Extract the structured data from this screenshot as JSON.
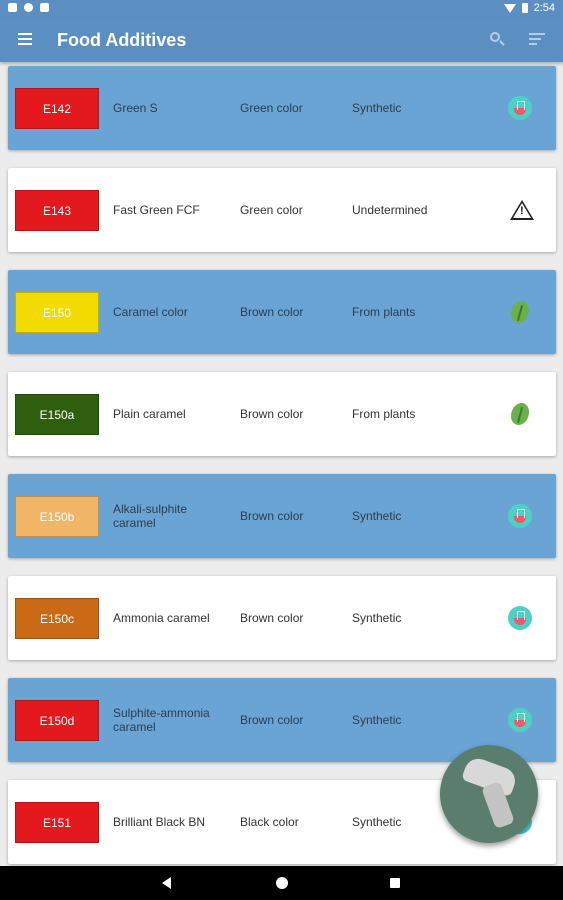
{
  "status_bar": {
    "time": "2:54"
  },
  "app_bar": {
    "title": "Food Additives",
    "icons": [
      "menu-icon",
      "search-icon",
      "sort-icon"
    ]
  },
  "additives": [
    {
      "code": "E142",
      "name": "Green S",
      "function": "Green color",
      "origin": "Synthetic",
      "code_color": "#e3191d",
      "origin_icon": "flask-icon",
      "highlight": true
    },
    {
      "code": "E143",
      "name": "Fast Green FCF",
      "function": "Green color",
      "origin": "Undetermined",
      "code_color": "#e3191d",
      "origin_icon": "warning-icon",
      "highlight": false
    },
    {
      "code": "E150",
      "name": "Caramel color",
      "function": "Brown color",
      "origin": "From plants",
      "code_color": "#f2dc00",
      "origin_icon": "leaf-icon",
      "highlight": true
    },
    {
      "code": "E150a",
      "name": "Plain caramel",
      "function": "Brown color",
      "origin": "From plants",
      "code_color": "#2f5e0e",
      "origin_icon": "leaf-icon",
      "highlight": false
    },
    {
      "code": "E150b",
      "name": "Alkali-sulphite caramel",
      "function": "Brown color",
      "origin": "Synthetic",
      "code_color": "#f0b566",
      "origin_icon": "flask-icon",
      "highlight": true
    },
    {
      "code": "E150c",
      "name": "Ammonia caramel",
      "function": "Brown color",
      "origin": "Synthetic",
      "code_color": "#ca6a16",
      "origin_icon": "flask-icon",
      "highlight": false
    },
    {
      "code": "E150d",
      "name": "Sulphite-ammonia caramel",
      "function": "Brown color",
      "origin": "Synthetic",
      "code_color": "#e3191d",
      "origin_icon": "flask-icon",
      "highlight": true
    },
    {
      "code": "E151",
      "name": "Brilliant Black BN",
      "function": "Black color",
      "origin": "Synthetic",
      "code_color": "#e3191d",
      "origin_icon": "flask-icon",
      "highlight": false
    }
  ],
  "colors": {
    "primary": "#5b8fc2",
    "highlight_card": "#6aa4d4",
    "fab": "#5a7d6d"
  },
  "fab": {
    "icon": "barcode-scanner-icon"
  },
  "nav_bar": {
    "icons": [
      "back-icon",
      "home-icon",
      "recent-apps-icon"
    ]
  }
}
